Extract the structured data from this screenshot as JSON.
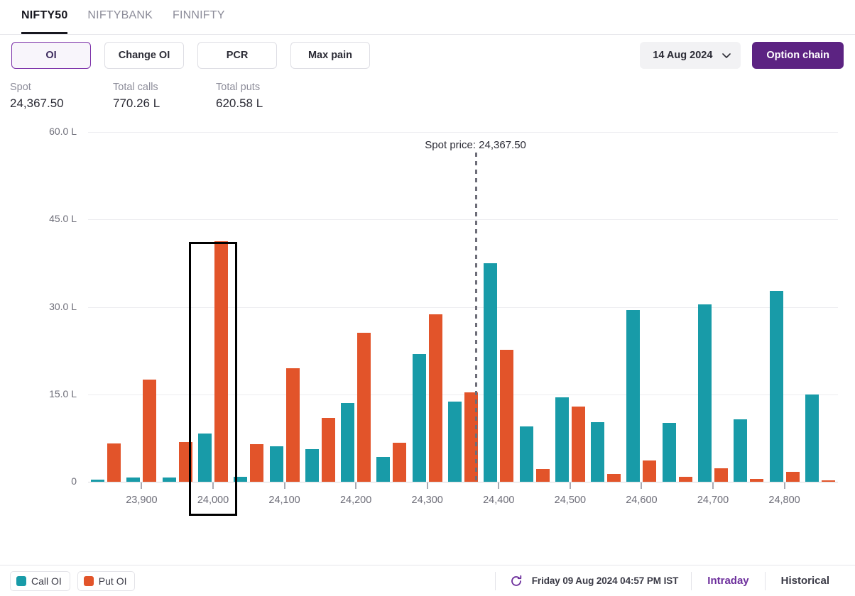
{
  "tabs": [
    {
      "label": "NIFTY50",
      "active": true
    },
    {
      "label": "NIFTYBANK",
      "active": false
    },
    {
      "label": "FINNIFTY",
      "active": false
    }
  ],
  "filters": [
    {
      "label": "OI",
      "selected": true
    },
    {
      "label": "Change OI",
      "selected": false
    },
    {
      "label": "PCR",
      "selected": false
    },
    {
      "label": "Max pain",
      "selected": false
    }
  ],
  "controls": {
    "expiry_date": "14 Aug 2024",
    "expiry_chevron_icon": "chevron-down-icon",
    "option_chain_label": "Option chain"
  },
  "stats": [
    {
      "key": "Spot",
      "value": "24,367.50"
    },
    {
      "key": "Total calls",
      "value": "770.26 L"
    },
    {
      "key": "Total puts",
      "value": "620.58 L"
    }
  ],
  "legend": [
    {
      "label": "Call OI",
      "color": "#189BA8",
      "icon": "call-oi-swatch"
    },
    {
      "label": "Put OI",
      "color": "#E2542A",
      "icon": "put-oi-swatch"
    }
  ],
  "footer": {
    "refresh_icon": "refresh-icon",
    "timestamp": "Friday 09 Aug 2024 04:57 PM IST",
    "modes": [
      {
        "label": "Intraday",
        "active": true
      },
      {
        "label": "Historical",
        "active": false
      }
    ]
  },
  "chart_data": {
    "type": "bar",
    "title": "",
    "xlabel": "",
    "ylabel": "",
    "ylim": [
      0,
      60
    ],
    "y_ticks": [
      0,
      15,
      30,
      45,
      60
    ],
    "y_tick_labels": [
      "0",
      "15.0 L",
      "30.0 L",
      "45.0 L",
      "60.0 L"
    ],
    "y_unit": "L",
    "grid": true,
    "legend_position": "bottom-left",
    "x_tick_labels": [
      "23,900",
      "24,000",
      "24,100",
      "24,200",
      "24,300",
      "24,400",
      "24,500",
      "24,600",
      "24,700",
      "24,800"
    ],
    "x_tick_strikes": [
      23900,
      24000,
      24100,
      24200,
      24300,
      24400,
      24500,
      24600,
      24700,
      24800
    ],
    "strikes": [
      23850,
      23900,
      23950,
      24000,
      24050,
      24100,
      24150,
      24200,
      24250,
      24300,
      24350,
      24400,
      24450,
      24500,
      24550,
      24600,
      24650,
      24700,
      24750,
      24800,
      24850
    ],
    "categories": [
      "23850",
      "23900",
      "23950",
      "24000",
      "24050",
      "24100",
      "24150",
      "24200",
      "24250",
      "24300",
      "24350",
      "24400",
      "24450",
      "24500",
      "24550",
      "24600",
      "24650",
      "24700",
      "24750",
      "24800",
      "24850"
    ],
    "series": [
      {
        "name": "Call OI",
        "color": "#189BA8",
        "values": [
          0.4,
          0.7,
          0.7,
          8.3,
          0.8,
          6.1,
          5.6,
          13.5,
          4.3,
          21.9,
          13.8,
          37.5,
          9.5,
          14.5,
          10.2,
          29.4,
          10.1,
          30.4,
          10.7,
          32.8,
          15.0
        ]
      },
      {
        "name": "Put OI",
        "color": "#E2542A",
        "values": [
          6.6,
          17.5,
          6.8,
          41.3,
          6.5,
          19.5,
          10.9,
          25.5,
          6.7,
          28.7,
          15.3,
          22.6,
          2.2,
          12.9,
          1.4,
          3.7,
          0.8,
          2.3,
          0.5,
          1.7,
          0.2
        ]
      }
    ],
    "annotations": [
      {
        "type": "vline",
        "label": "Spot price: 24,367.50",
        "value": 24367.5
      }
    ],
    "highlight": {
      "strike": "24,000",
      "style": "black-rectangle"
    }
  }
}
